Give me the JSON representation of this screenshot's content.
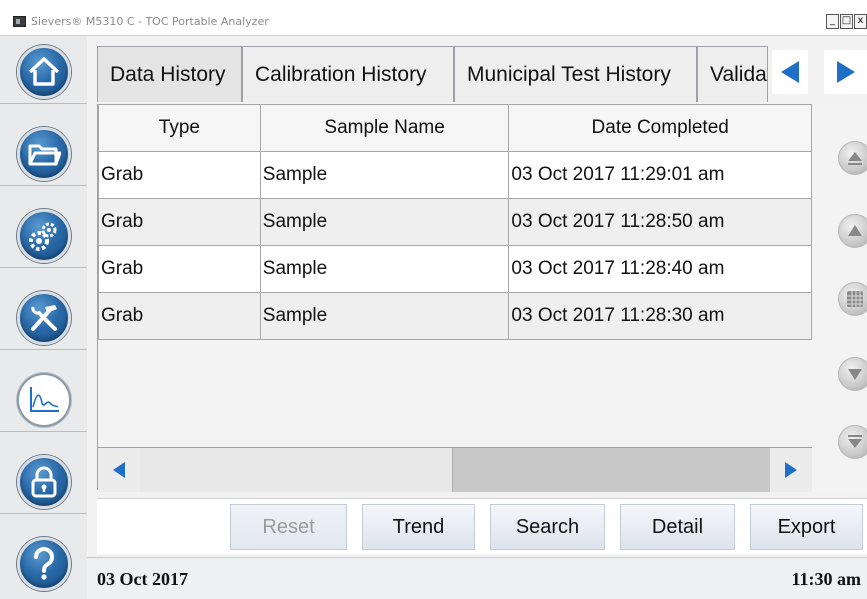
{
  "window": {
    "title": "Sievers® M5310 C - TOC Portable Analyzer",
    "controls": {
      "minimize": "_",
      "maximize": "□",
      "close": "x"
    }
  },
  "sidebar": {
    "items": [
      {
        "name": "home",
        "icon": "home-icon"
      },
      {
        "name": "data",
        "icon": "folder-icon"
      },
      {
        "name": "setup",
        "icon": "gears-icon"
      },
      {
        "name": "maintenance",
        "icon": "tools-icon"
      },
      {
        "name": "trend",
        "icon": "chart-icon",
        "active": true
      },
      {
        "name": "security",
        "icon": "lock-icon"
      },
      {
        "name": "help",
        "icon": "question-icon"
      }
    ]
  },
  "tabs": [
    {
      "label": "Data History",
      "selected": true
    },
    {
      "label": "Calibration History"
    },
    {
      "label": "Municipal Test History"
    },
    {
      "label": "Valida"
    }
  ],
  "table": {
    "columns": [
      "Type",
      "Sample Name",
      "Date Completed"
    ],
    "rows": [
      {
        "type": "Grab",
        "sample_name": "Sample",
        "date_completed": "03 Oct 2017 11:29:01 am"
      },
      {
        "type": "Grab",
        "sample_name": "Sample",
        "date_completed": "03 Oct 2017 11:28:50 am"
      },
      {
        "type": "Grab",
        "sample_name": "Sample",
        "date_completed": "03 Oct 2017 11:28:40 am"
      },
      {
        "type": "Grab",
        "sample_name": "Sample",
        "date_completed": "03 Oct 2017 11:28:30 am"
      }
    ]
  },
  "buttons": {
    "reset": "Reset",
    "trend": "Trend",
    "search": "Search",
    "detail": "Detail",
    "export": "Export"
  },
  "status": {
    "date": "03 Oct 2017",
    "time": "11:30 am"
  },
  "colors": {
    "accent_blue": "#1f6fc9",
    "sidebar_circle": "#2a6aa8"
  }
}
